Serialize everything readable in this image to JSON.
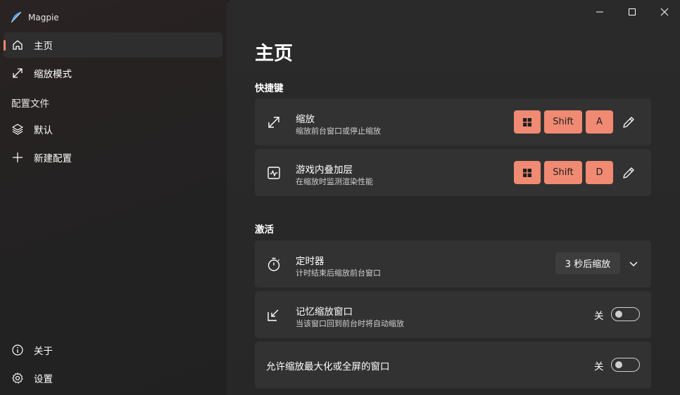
{
  "app": {
    "name": "Magpie"
  },
  "sidebar": {
    "items": [
      {
        "label": "主页",
        "icon": "home-icon",
        "active": true
      },
      {
        "label": "缩放模式",
        "icon": "expand-arrows-icon",
        "active": false
      }
    ],
    "profiles_section": "配置文件",
    "profiles": [
      {
        "label": "默认",
        "icon": "layers-icon"
      },
      {
        "label": "新建配置",
        "icon": "plus-icon"
      }
    ],
    "footer": [
      {
        "label": "关于",
        "icon": "info-icon"
      },
      {
        "label": "设置",
        "icon": "gear-icon"
      }
    ]
  },
  "window_controls": [
    "minimize",
    "maximize",
    "close"
  ],
  "page": {
    "title": "主页"
  },
  "hotkeys": {
    "title": "快捷键",
    "items": [
      {
        "title": "缩放",
        "desc": "缩放前台窗口或停止缩放",
        "icon": "expand-arrows-icon",
        "keys": [
          "win",
          "Shift",
          "A"
        ]
      },
      {
        "title": "游戏内叠加层",
        "desc": "在缩放时监测渲染性能",
        "icon": "activity-monitor-icon",
        "keys": [
          "win",
          "Shift",
          "D"
        ]
      }
    ]
  },
  "activation": {
    "title": "激活",
    "timer": {
      "title": "定时器",
      "desc": "计时结束后缩放前台窗口",
      "icon": "stopwatch-icon",
      "value": "3 秒后缩放"
    },
    "remember": {
      "title": "记忆缩放窗口",
      "desc": "当该窗口回到前台时将自动缩放",
      "icon": "arrow-in-window-icon",
      "state_label": "关",
      "on": false
    },
    "allow_max": {
      "title": "允许缩放最大化或全屏的窗口",
      "state_label": "关",
      "on": false
    }
  },
  "colors": {
    "accent": "#f08a72",
    "card": "#323232",
    "background": "#272727"
  }
}
